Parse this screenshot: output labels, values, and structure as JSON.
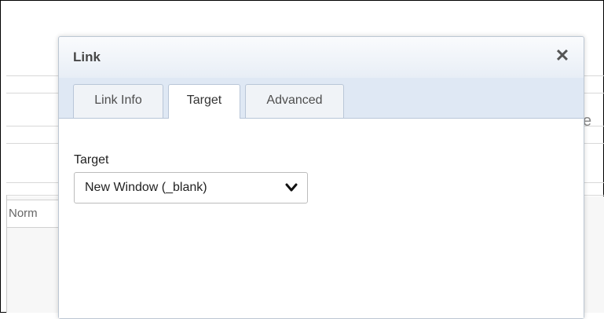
{
  "background": {
    "format_label": "Norm",
    "partial_text": "e"
  },
  "dialog": {
    "title": "Link",
    "close_glyph": "✕"
  },
  "tabs": [
    {
      "label": "Link Info",
      "active": false
    },
    {
      "label": "Target",
      "active": true
    },
    {
      "label": "Advanced",
      "active": false
    }
  ],
  "target": {
    "label": "Target",
    "selected": "New Window (_blank)"
  },
  "icons": {
    "close": "close-icon",
    "dropdown": "chevron-down-icon"
  },
  "colors": {
    "header_gradient_end": "#e8eef6",
    "tab_strip": "#dfe8f4",
    "border": "#bcc7d3"
  }
}
